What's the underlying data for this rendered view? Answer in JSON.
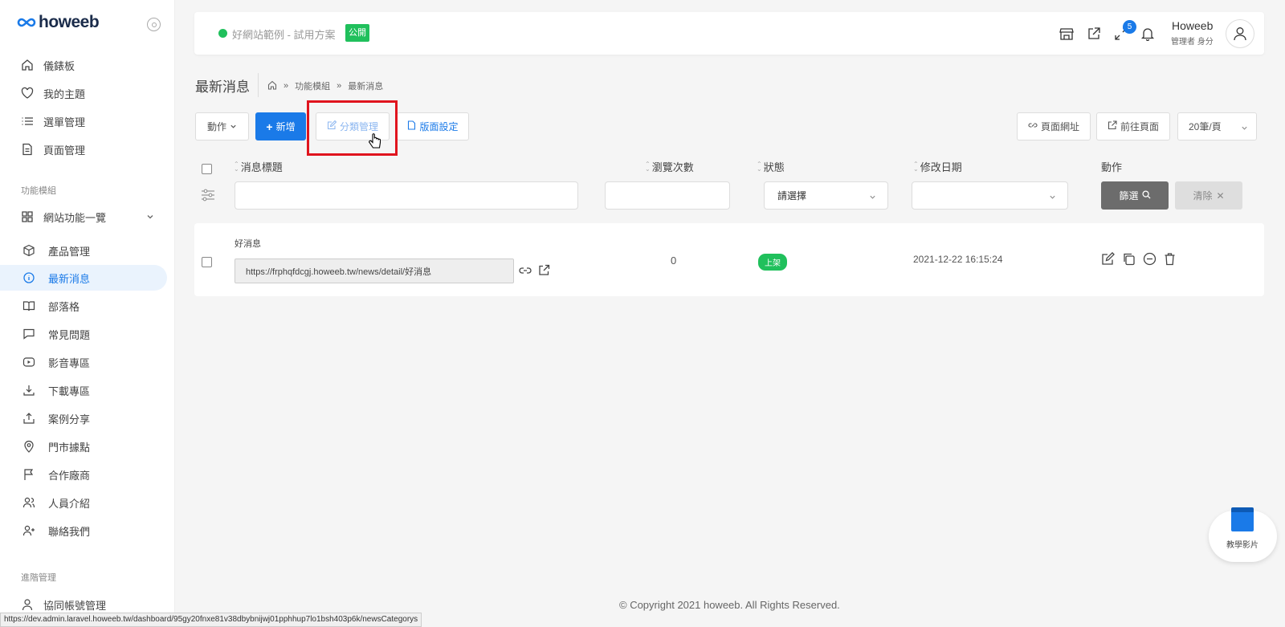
{
  "brand": {
    "logo_text": "howeeb"
  },
  "sidebar": {
    "items": [
      {
        "label": "儀錶板",
        "icon": "home-icon"
      },
      {
        "label": "我的主題",
        "icon": "heart-icon"
      },
      {
        "label": "選單管理",
        "icon": "list-icon"
      },
      {
        "label": "頁面管理",
        "icon": "page-icon"
      }
    ],
    "section_modules": "功能模組",
    "group_label": "網站功能一覽",
    "sub_items": [
      {
        "label": "產品管理",
        "icon": "box-icon"
      },
      {
        "label": "最新消息",
        "icon": "info-icon"
      },
      {
        "label": "部落格",
        "icon": "book-icon"
      },
      {
        "label": "常見問題",
        "icon": "chat-icon"
      },
      {
        "label": "影音專區",
        "icon": "video-icon"
      },
      {
        "label": "下載專區",
        "icon": "download-icon"
      },
      {
        "label": "案例分享",
        "icon": "share-icon"
      },
      {
        "label": "門市據點",
        "icon": "location-icon"
      },
      {
        "label": "合作廠商",
        "icon": "flag-icon"
      },
      {
        "label": "人員介紹",
        "icon": "users-icon"
      },
      {
        "label": "聯絡我們",
        "icon": "user-plus-icon"
      }
    ],
    "section_advanced": "進階管理",
    "advanced_items": [
      {
        "label": "協同帳號管理",
        "icon": "user-icon"
      }
    ]
  },
  "topbar": {
    "site_name": "好網站範例 - 試用方案",
    "public_badge": "公開",
    "notification_count": "5",
    "user_name": "Howeeb",
    "user_role": "管理者 身分"
  },
  "page": {
    "title": "最新消息",
    "breadcrumb": [
      "功能模組",
      "最新消息"
    ]
  },
  "toolbar": {
    "action_label": "動作",
    "add_label": "新增",
    "category_label": "分類管理",
    "layout_label": "版面設定",
    "page_url_label": "頁面網址",
    "goto_page_label": "前往頁面",
    "per_page": "20筆/頁"
  },
  "table": {
    "headers": {
      "title": "消息標題",
      "views": "瀏覽次數",
      "status": "狀態",
      "modified": "修改日期",
      "actions": "動作"
    },
    "status_placeholder": "請選擇",
    "filter_label": "篩選",
    "clear_label": "清除",
    "rows": [
      {
        "title": "好消息",
        "url": "https://frphqfdcgj.howeeb.tw/news/detail/好消息",
        "views": "0",
        "status": "上架",
        "modified": "2021-12-22 16:15:24"
      }
    ]
  },
  "footer": {
    "copyright": "© Copyright 2021 howeeb. All Rights Reserved."
  },
  "status_bar": {
    "url": "https://dev.admin.laravel.howeeb.tw/dashboard/95gy20fnxe81v38dbybnijwj01pphhup7lo1bsh403p6k/newsCategorys"
  },
  "tutorial": {
    "label": "教學影片"
  },
  "colors": {
    "accent": "#1a7ae8",
    "success": "#20c05c",
    "highlight": "#e0141e"
  }
}
